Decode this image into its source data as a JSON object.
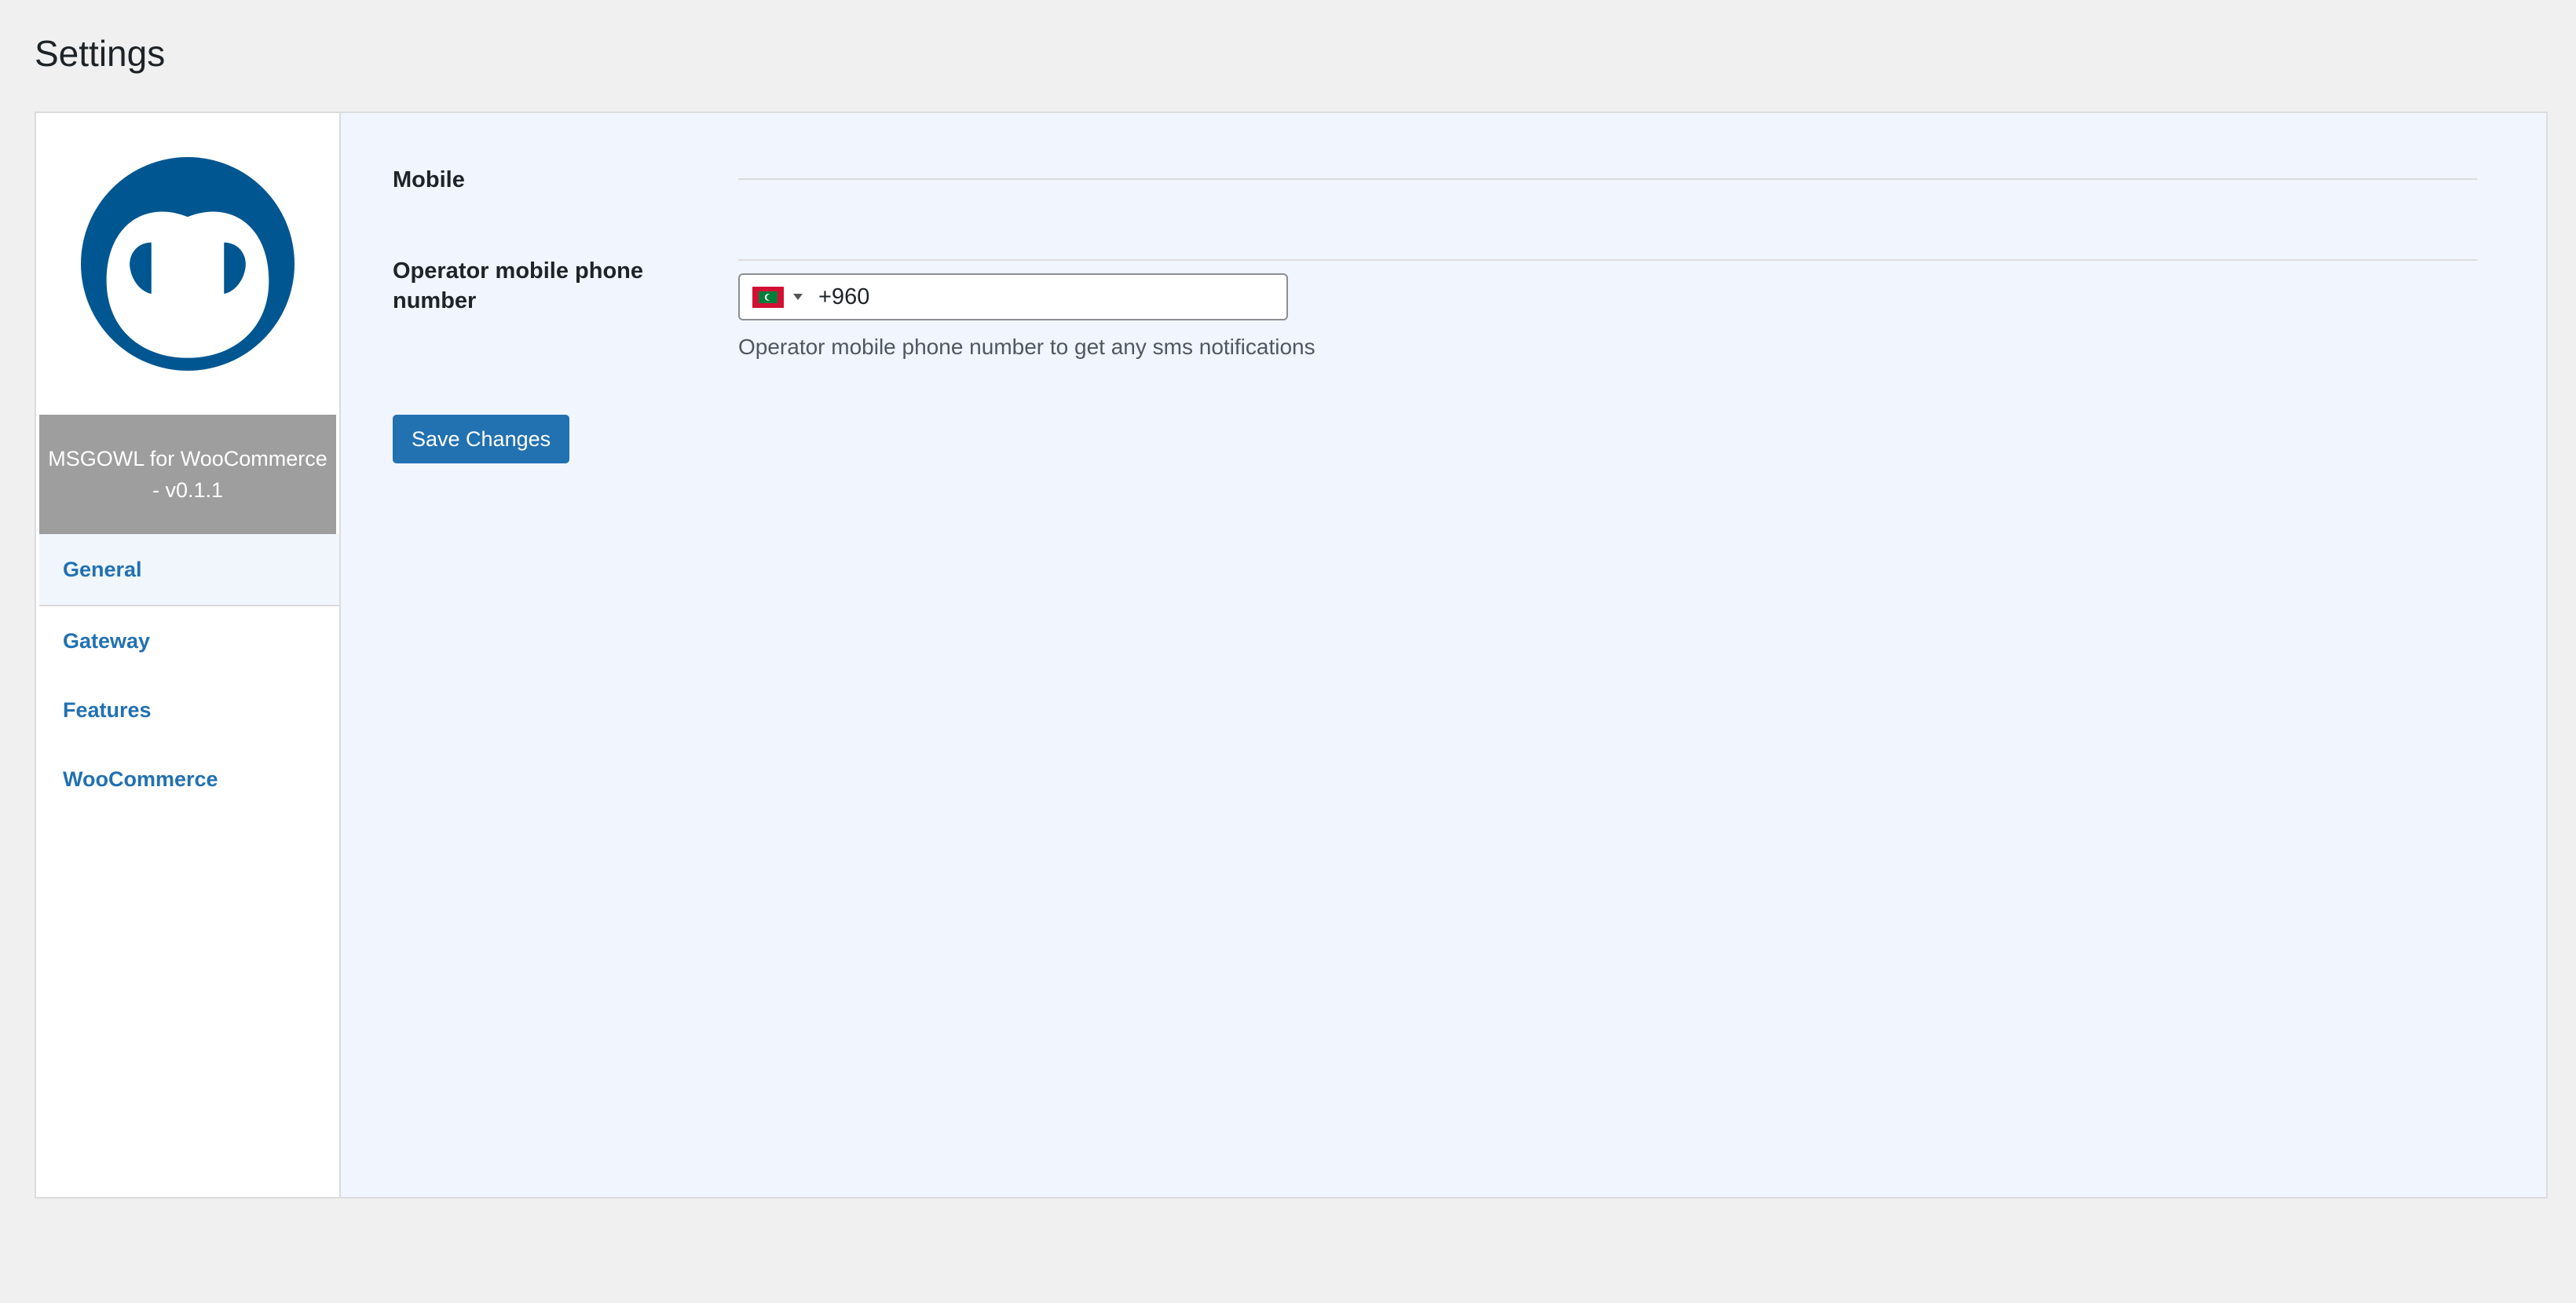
{
  "page": {
    "title": "Settings"
  },
  "sidebar": {
    "logo_icon": "owl-logo-icon",
    "plugin_name": "MSGOWL for WooCommerce - v0.1.1",
    "active_index": 0,
    "items": [
      {
        "label": "General"
      },
      {
        "label": "Gateway"
      },
      {
        "label": "Features"
      },
      {
        "label": "WooCommerce"
      }
    ]
  },
  "main": {
    "section_heading": "Mobile",
    "operator_phone": {
      "label": "Operator mobile phone number",
      "country_flag": "maldives-flag-icon",
      "value": "+960",
      "description": "Operator mobile phone number to get any sms notifications"
    },
    "save_label": "Save Changes"
  },
  "colors": {
    "brand": "#005690",
    "link": "#2271b1",
    "button_bg": "#2271b1",
    "banner_bg": "#9e9e9e",
    "content_bg": "#f0f5fe",
    "page_bg": "#f0f0f1"
  }
}
